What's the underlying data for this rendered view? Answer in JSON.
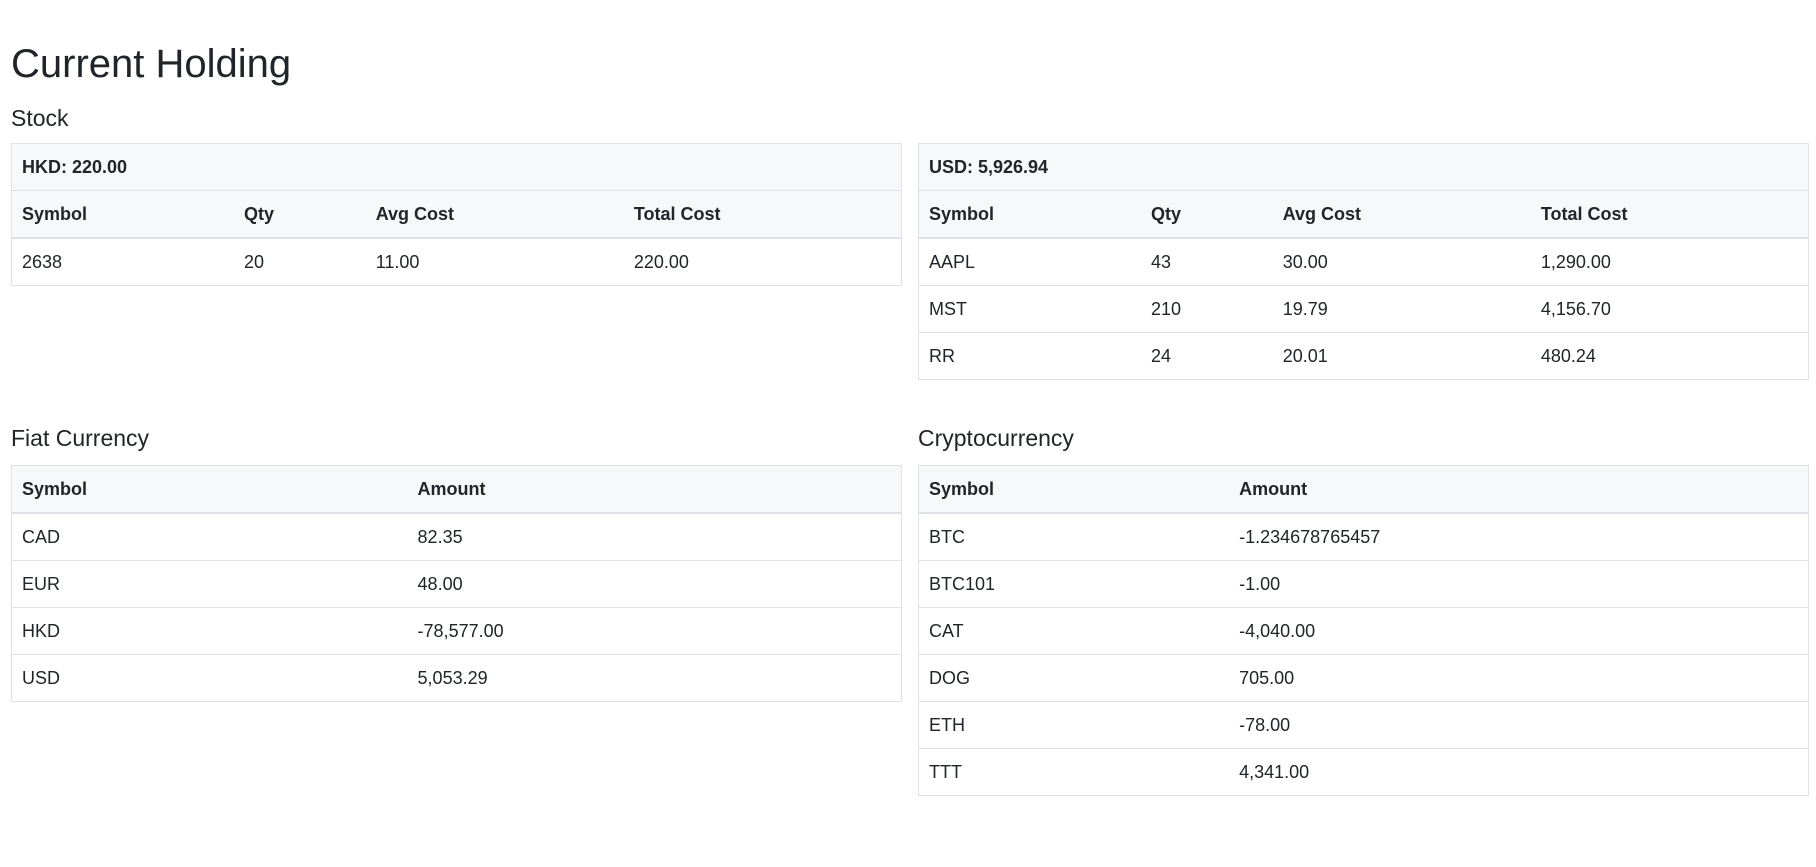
{
  "page": {
    "title": "Current Holding"
  },
  "stock": {
    "title": "Stock",
    "columns": [
      "Symbol",
      "Qty",
      "Avg Cost",
      "Total Cost"
    ],
    "tables": [
      {
        "caption": "HKD: 220.00",
        "rows": [
          [
            "2638",
            "20",
            "11.00",
            "220.00"
          ]
        ]
      },
      {
        "caption": "USD: 5,926.94",
        "rows": [
          [
            "AAPL",
            "43",
            "30.00",
            "1,290.00"
          ],
          [
            "MST",
            "210",
            "19.79",
            "4,156.70"
          ],
          [
            "RR",
            "24",
            "20.01",
            "480.24"
          ]
        ]
      }
    ]
  },
  "fiat": {
    "title": "Fiat Currency",
    "columns": [
      "Symbol",
      "Amount"
    ],
    "rows": [
      [
        "CAD",
        "82.35"
      ],
      [
        "EUR",
        "48.00"
      ],
      [
        "HKD",
        "-78,577.00"
      ],
      [
        "USD",
        "5,053.29"
      ]
    ]
  },
  "crypto": {
    "title": "Cryptocurrency",
    "columns": [
      "Symbol",
      "Amount"
    ],
    "rows": [
      [
        "BTC",
        "-1.234678765457"
      ],
      [
        "BTC101",
        "-1.00"
      ],
      [
        "CAT",
        "-4,040.00"
      ],
      [
        "DOG",
        "705.00"
      ],
      [
        "ETH",
        "-78.00"
      ],
      [
        "TTT",
        "4,341.00"
      ]
    ]
  }
}
